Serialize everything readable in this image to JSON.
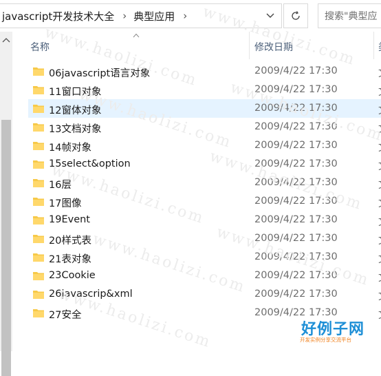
{
  "address": {
    "path": [
      "javascript开发技术大全",
      "典型应用"
    ],
    "separator": "›"
  },
  "search": {
    "placeholder": "搜索\"典型应"
  },
  "columns": {
    "name": "名称",
    "modified": "修改日期",
    "type": "类"
  },
  "rows": [
    {
      "name": "06javascript语言对象",
      "date": "2009/4/22 17:30",
      "type": "文"
    },
    {
      "name": "11窗口对象",
      "date": "2009/4/22 17:30",
      "type": "文"
    },
    {
      "name": "12窗体对象",
      "date": "2009/4/22 17:30",
      "type": "文",
      "hover": true
    },
    {
      "name": "13文档对象",
      "date": "2009/4/22 17:30",
      "type": "文"
    },
    {
      "name": "14帧对象",
      "date": "2009/4/22 17:30",
      "type": "文"
    },
    {
      "name": "15select&option",
      "date": "2009/4/22 17:30",
      "type": "文"
    },
    {
      "name": "16层",
      "date": "2009/4/22 17:30",
      "type": "文"
    },
    {
      "name": "17图像",
      "date": "2009/4/22 17:30",
      "type": "文"
    },
    {
      "name": "19Event",
      "date": "2009/4/22 17:30",
      "type": "文"
    },
    {
      "name": "20样式表",
      "date": "2009/4/22 17:30",
      "type": "文"
    },
    {
      "name": "21表对象",
      "date": "2009/4/22 17:30",
      "type": "文"
    },
    {
      "name": "23Cookie",
      "date": "2009/4/22 17:30",
      "type": "文"
    },
    {
      "name": "26javascrip&xml",
      "date": "2009/4/22 17:30",
      "type": "文"
    },
    {
      "name": "27安全",
      "date": "2009/4/22 17:30",
      "type": "文"
    }
  ],
  "watermark": {
    "text": "www.haolizi.com",
    "logo_main": "好例子网",
    "logo_sub": "开发实例分享交流平台"
  },
  "colors": {
    "folder": "#f7c948",
    "hover_row": "#e5f3ff",
    "header_text": "#4c607a",
    "logo_blue": "#1e8fd6",
    "logo_orange": "#f07f1a"
  },
  "icons": {
    "address_dropdown": "chevron-down-icon",
    "refresh": "refresh-icon",
    "folder": "folder-icon",
    "sort": "sort-ascending-icon"
  }
}
